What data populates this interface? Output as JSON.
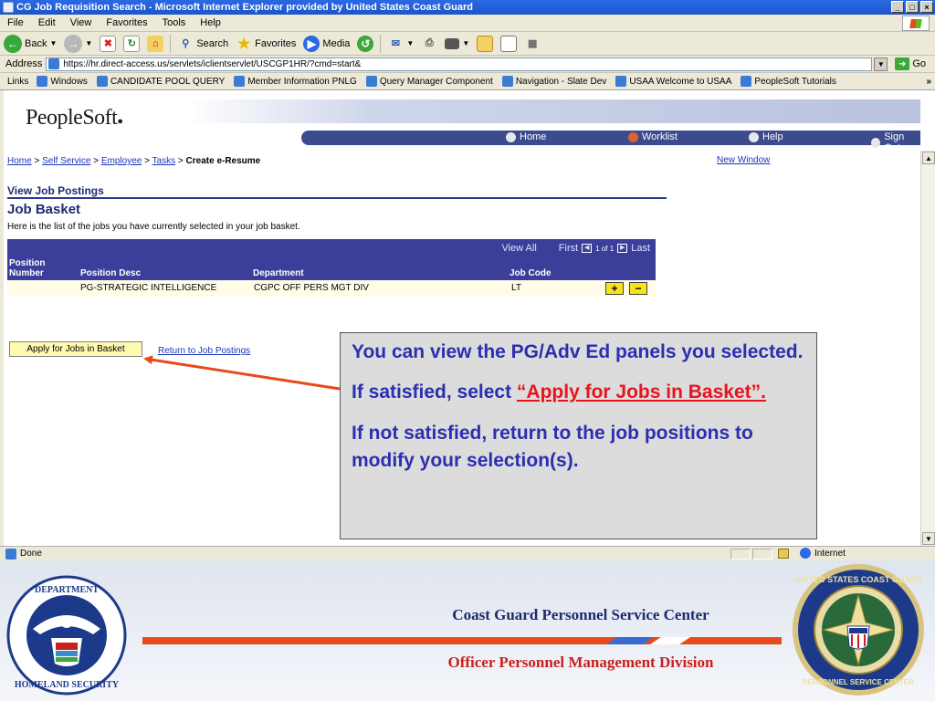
{
  "window": {
    "title": "CG Job Requisition Search - Microsoft Internet Explorer provided by United States Coast Guard",
    "controls": [
      "_",
      "□",
      "×"
    ]
  },
  "menu": [
    "File",
    "Edit",
    "View",
    "Favorites",
    "Tools",
    "Help"
  ],
  "toolbar": {
    "back": "Back",
    "search": "Search",
    "favorites": "Favorites",
    "media": "Media"
  },
  "address": {
    "label": "Address",
    "url": "https://hr.direct-access.us/servlets/iclientservlet/USCGP1HR/?cmd=start&",
    "go": "Go"
  },
  "links": {
    "label": "Links",
    "items": [
      "Windows",
      "CANDIDATE POOL QUERY",
      "Member Information PNLG",
      "Query Manager Component",
      "Navigation - Slate Dev",
      "USAA  Welcome to USAA",
      "PeopleSoft Tutorials"
    ],
    "more": "»"
  },
  "peoplesoft": {
    "logo": "PeopleSoft",
    "nav": {
      "home": "Home",
      "worklist": "Worklist",
      "help": "Help",
      "signout": "Sign Out"
    }
  },
  "breadcrumb": {
    "items": [
      "Home",
      "Self Service",
      "Employee",
      "Tasks"
    ],
    "separator": ">",
    "current": "Create e-Resume"
  },
  "new_window": "New Window",
  "section_title": "View Job Postings",
  "page_title": "Job Basket",
  "page_desc": "Here is the list of the jobs you have currently selected in your job basket.",
  "grid": {
    "view_all": "View All",
    "first": "First",
    "count": "1 of 1",
    "last": "Last",
    "columns": {
      "position_number": "Position Number",
      "position_desc": "Position Desc",
      "department": "Department",
      "job_code": "Job Code"
    },
    "rows": [
      {
        "position_number": "",
        "position_desc": "PG-STRATEGIC INTELLIGENCE",
        "department": "CGPC OFF PERS MGT DIV",
        "job_code": "LT"
      }
    ],
    "add_label": "+",
    "remove_label": "−"
  },
  "apply_button": "Apply for Jobs in Basket",
  "return_link": "Return to Job Postings",
  "callout": {
    "p1": "You can view the PG/Adv Ed panels you selected.",
    "p2_prefix": "If satisfied, select ",
    "p2_highlight": "“Apply for Jobs in Basket”.",
    "p3": "If not satisfied, return to the job positions to modify your selection(s)."
  },
  "statusbar": {
    "status": "Done",
    "zone": "Internet"
  },
  "footer": {
    "title": "Coast Guard Personnel Service Center",
    "subtitle": "Officer Personnel Management Division",
    "dhs_seal_text": "U.S. DEPARTMENT OF HOMELAND SECURITY",
    "uscg_seal_text": "UNITED STATES COAST GUARD PERSONNEL SERVICE CENTER"
  },
  "colors": {
    "ps_nav": "#3c4a8e",
    "grid_header": "#3c3f9a",
    "callout_text": "#2b2fb0",
    "highlight_red": "#e8141c",
    "arrow": "#e84a1b"
  }
}
